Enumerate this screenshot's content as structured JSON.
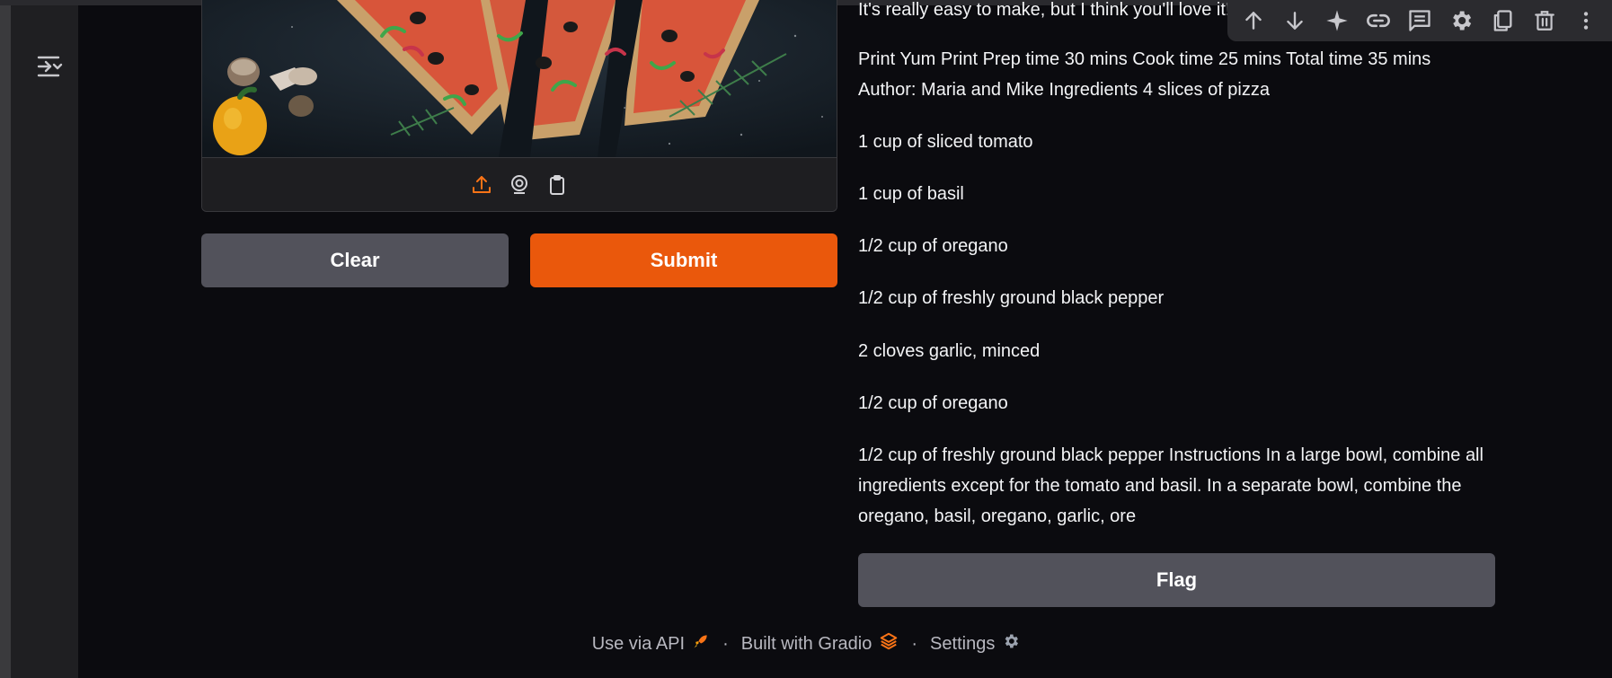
{
  "sidebar": {
    "toggle_icon": "sidebar-collapse-icon"
  },
  "image_input": {
    "toolbar": [
      {
        "icon": "upload-icon",
        "color": "#f97316"
      },
      {
        "icon": "webcam-icon",
        "color": "#d4d4d8"
      },
      {
        "icon": "clipboard-icon",
        "color": "#d4d4d8"
      }
    ]
  },
  "buttons": {
    "clear_label": "Clear",
    "submit_label": "Submit",
    "flag_label": "Flag"
  },
  "output": {
    "paragraphs": [
      "It's really easy to make, but I think you'll love it!",
      "Print Yum Print Prep time 30 mins Cook time 25 mins Total time 35 mins Author: Maria and Mike Ingredients 4 slices of pizza",
      "1 cup of sliced tomato",
      "1 cup of basil",
      "1/2 cup of oregano",
      "1/2 cup of freshly ground black pepper",
      "2 cloves garlic, minced",
      "1/2 cup of oregano",
      "1/2 cup of freshly ground black pepper Instructions In a large bowl, combine all ingredients except for the tomato and basil. In a separate bowl, combine the oregano, basil, oregano, garlic, ore"
    ]
  },
  "float_toolbar": {
    "icons": [
      "arrow-up-icon",
      "arrow-down-icon",
      "sparkle-icon",
      "link-icon",
      "comment-icon",
      "gear-icon",
      "duplicate-icon",
      "trash-icon",
      "more-vertical-icon"
    ]
  },
  "footer": {
    "api_label": "Use via API",
    "built_label": "Built with Gradio",
    "settings_label": "Settings",
    "separator": "·"
  },
  "colors": {
    "accent": "#ea580c",
    "background": "#0b0b0f",
    "button_secondary": "#52525b"
  }
}
